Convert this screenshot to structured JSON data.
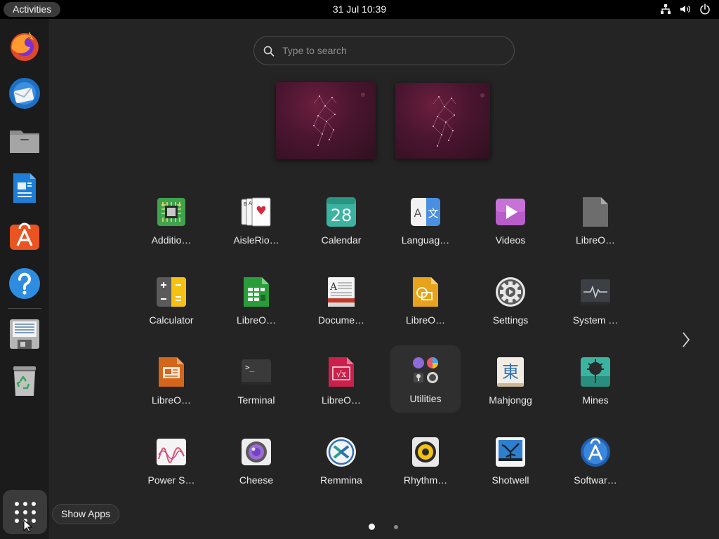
{
  "topbar": {
    "activities_label": "Activities",
    "clock": "31 Jul  10:39",
    "tray_icons": [
      "network-icon",
      "volume-icon",
      "power-icon"
    ]
  },
  "dock": {
    "items": [
      {
        "name": "firefox-icon"
      },
      {
        "name": "thunderbird-icon"
      },
      {
        "name": "files-icon"
      },
      {
        "name": "libreoffice-writer-icon"
      },
      {
        "name": "app-center-icon"
      },
      {
        "name": "help-icon"
      },
      {
        "name": "text-editor-icon"
      },
      {
        "name": "trash-icon"
      }
    ],
    "show_apps_tooltip": "Show Apps"
  },
  "search": {
    "placeholder": "Type to search"
  },
  "apps": [
    {
      "label": "Additio…",
      "icon": "additional-drivers-icon"
    },
    {
      "label": "AisleRio…",
      "icon": "aisleriot-cards-icon"
    },
    {
      "label": "Calendar",
      "icon": "calendar-icon",
      "badge": "28"
    },
    {
      "label": "Languag…",
      "icon": "language-icon",
      "glyph_a": "A",
      "glyph_b": "文"
    },
    {
      "label": "Videos",
      "icon": "videos-icon"
    },
    {
      "label": "LibreO…",
      "icon": "libreoffice-icon"
    },
    {
      "label": "Calculator",
      "icon": "calculator-icon"
    },
    {
      "label": "LibreO…",
      "icon": "libreoffice-calc-icon"
    },
    {
      "label": "Docume…",
      "icon": "document-viewer-icon"
    },
    {
      "label": "LibreO…",
      "icon": "libreoffice-draw-icon"
    },
    {
      "label": "Settings",
      "icon": "settings-icon"
    },
    {
      "label": "System …",
      "icon": "system-monitor-icon"
    },
    {
      "label": "LibreO…",
      "icon": "libreoffice-impress-icon"
    },
    {
      "label": "Terminal",
      "icon": "terminal-icon",
      "glyph": ">_"
    },
    {
      "label": "LibreO…",
      "icon": "libreoffice-math-icon",
      "glyph": "√x"
    },
    {
      "label": "Utilities",
      "icon": "utilities-folder-icon"
    },
    {
      "label": "Mahjongg",
      "icon": "mahjongg-icon",
      "glyph": "東"
    },
    {
      "label": "Mines",
      "icon": "mines-icon"
    },
    {
      "label": "Power S…",
      "icon": "power-statistics-icon"
    },
    {
      "label": "Cheese",
      "icon": "cheese-icon"
    },
    {
      "label": "Remmina",
      "icon": "remmina-icon"
    },
    {
      "label": "Rhythm…",
      "icon": "rhythmbox-icon"
    },
    {
      "label": "Shotwell",
      "icon": "shotwell-icon"
    },
    {
      "label": "Softwar…",
      "icon": "software-updater-icon"
    }
  ],
  "pagination": {
    "current_page": 1,
    "page_count": 2
  }
}
